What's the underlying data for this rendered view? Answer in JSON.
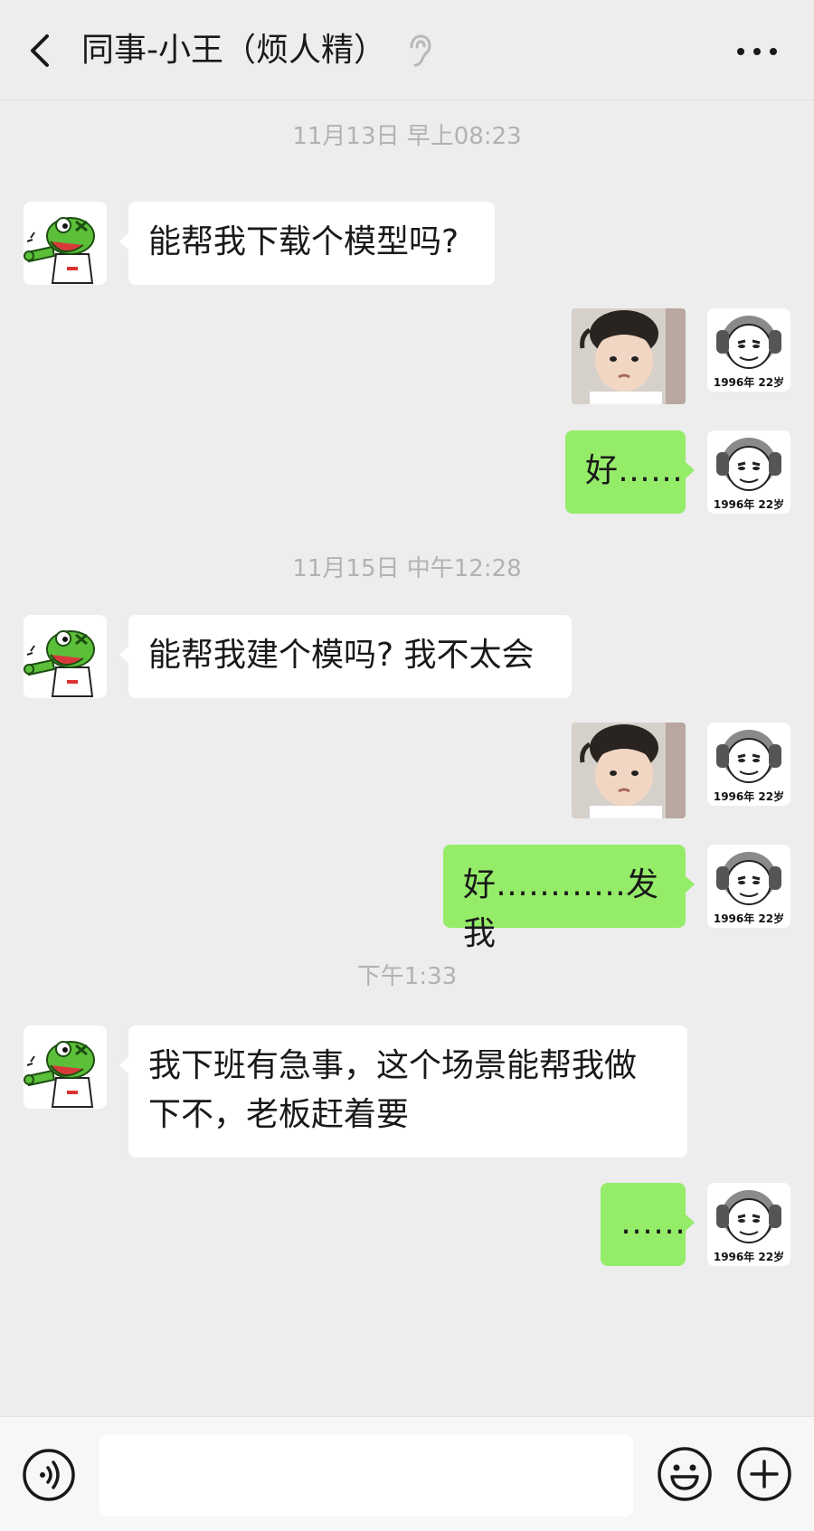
{
  "header": {
    "title": "同事-小王（烦人精）",
    "back_icon": "chevron-left-icon",
    "ear_icon": "ear-icon",
    "more_icon": "more-dots-icon"
  },
  "messages": [
    {
      "kind": "timestamp",
      "text": "11月13日 早上08:23"
    },
    {
      "kind": "text",
      "side": "in",
      "text": "能帮我下载个模型吗?"
    },
    {
      "kind": "sticker",
      "side": "out"
    },
    {
      "kind": "text",
      "side": "out",
      "text": "好……"
    },
    {
      "kind": "timestamp",
      "text": "11月15日 中午12:28"
    },
    {
      "kind": "text",
      "side": "in",
      "text": "能帮我建个模吗? 我不太会"
    },
    {
      "kind": "sticker",
      "side": "out"
    },
    {
      "kind": "text",
      "side": "out",
      "text": "好…………发我"
    },
    {
      "kind": "timestamp",
      "text": "下午1:33"
    },
    {
      "kind": "text",
      "side": "in",
      "text_line1": "我下班有急事，这个场景能帮我做",
      "text_line2": "下不，老板赶着要"
    },
    {
      "kind": "text",
      "side": "out",
      "text": "……"
    }
  ],
  "self_avatar_caption": "1996年 22岁",
  "input": {
    "value": "",
    "placeholder": ""
  },
  "colors": {
    "background": "#ededed",
    "outgoing_bubble": "#95ec69",
    "incoming_bubble": "#ffffff",
    "timestamp": "#b2b2b2"
  }
}
